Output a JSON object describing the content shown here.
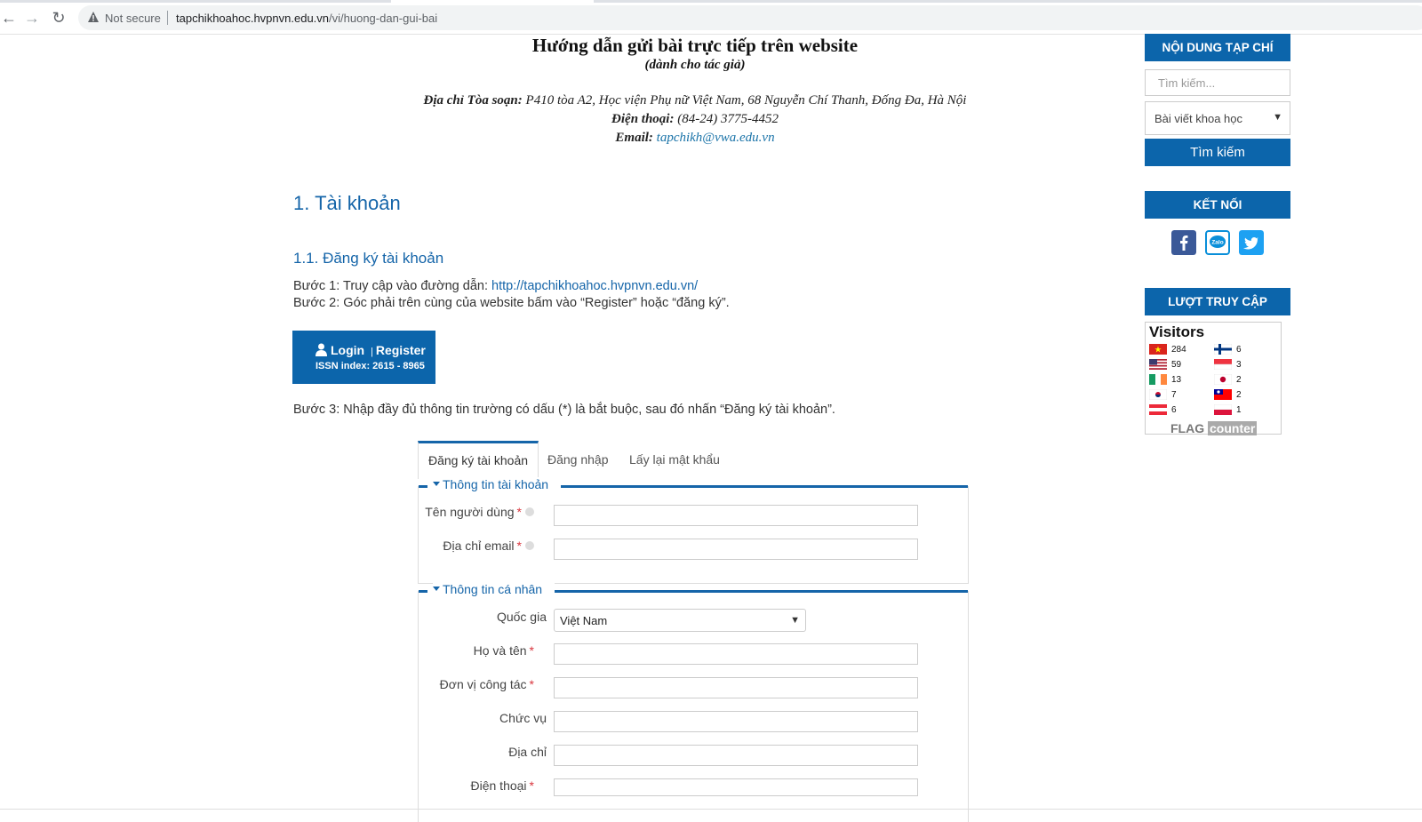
{
  "browser": {
    "security": "Not secure",
    "url_domain": "tapchikhoahoc.hvpnvn.edu.vn",
    "url_path": "/vi/huong-dan-gui-bai"
  },
  "header": {
    "title": "Hướng dẫn gửi bài trực tiếp trên website",
    "subtitle": "(dành cho tác giả)",
    "address_label": "Địa chỉ Tòa soạn:",
    "address_value": " P410 tòa A2, Học viện Phụ nữ Việt Nam, 68 Nguyễn Chí Thanh, Đống Đa, Hà Nội",
    "phone_label": "Điện thoại:",
    "phone_value": " (84-24) 3775-4452",
    "email_label": "Email:",
    "email_value": "tapchikh@vwa.edu.vn"
  },
  "content": {
    "h1": "1. Tài khoản",
    "h2": "1.1. Đăng ký tài khoản",
    "step1_text": "Bước 1: Truy cập vào đường dẫn: ",
    "step1_link": "http://tapchikhoahoc.hvpnvn.edu.vn/",
    "step2": "Bước 2: Góc phải trên cùng của website bấm vào “Register” hoặc “đăng ký”.",
    "step3": "Bước 3: Nhập đầy đủ thông tin trường có dấu (*) là bắt buộc, sau đó nhấn “Đăng ký tài khoản”.",
    "login_box": {
      "login": "Login",
      "sep": "|",
      "register": "Register",
      "issn": "ISSN index: 2615 - 8965"
    }
  },
  "form": {
    "tabs": [
      "Đăng ký tài khoản",
      "Đăng nhập",
      "Lấy lại mật khẩu"
    ],
    "section_account": "Thông tin tài khoản",
    "section_personal": "Thông tin cá nhân",
    "required_mark": "*",
    "fields": {
      "username": "Tên người dùng",
      "email": "Địa chỉ email",
      "country": "Quốc gia",
      "country_value": "Việt Nam",
      "fullname": "Họ và tên",
      "organization": "Đơn vị công tác",
      "position": "Chức vụ",
      "address": "Địa chỉ",
      "phone": "Điện thoại"
    }
  },
  "sidebar": {
    "journal_heading": "NỘI DUNG TẠP CHÍ",
    "search_placeholder": "Tìm kiếm...",
    "category_value": "Bài viết khoa học",
    "search_button": "Tìm kiếm",
    "connect_heading": "KẾT NỐI",
    "visits_heading": "LƯỢT TRUY CẬP",
    "social_icons": [
      "facebook-icon",
      "zalo-icon",
      "twitter-icon"
    ],
    "zalo_text": "Zalo",
    "visitors_title": "Visitors",
    "visitor_counts_left": [
      "284",
      "59",
      "13",
      "7",
      "6"
    ],
    "visitor_counts_right": [
      "6",
      "3",
      "2",
      "2",
      "1"
    ],
    "flagcounter_flag": "FLAG",
    "flagcounter_counter": "counter"
  },
  "colors": {
    "brand_blue": "#0c65ab",
    "link_blue": "#1565a9",
    "required_red": "#d9363e"
  }
}
